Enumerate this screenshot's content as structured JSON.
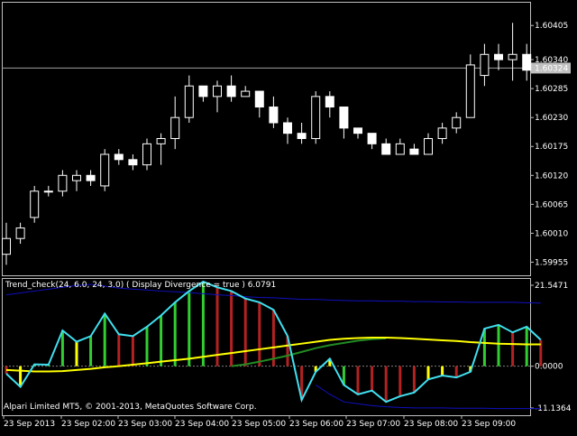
{
  "price_panel": {
    "current_price_tag": "1.60324",
    "price_ticks": [
      "1.60405",
      "1.60340",
      "1.60285",
      "1.60230",
      "1.60175",
      "1.60120",
      "1.60065",
      "1.60010",
      "1.59955"
    ]
  },
  "indicator_panel": {
    "title": "Trend_check(24, 6.0, 24, 3.0) ( Display Divergence = true ) 6.0791",
    "ticks": [
      "21.5471",
      "0.0000",
      "-11.1364"
    ]
  },
  "footer": {
    "copyright": "Alpari Limited MT5, © 2001-2013, MetaQuotes Software Corp."
  },
  "time_axis": {
    "labels": [
      "23 Sep 2013",
      "23 Sep 02:00",
      "23 Sep 03:00",
      "23 Sep 04:00",
      "23 Sep 05:00",
      "23 Sep 06:00",
      "23 Sep 07:00",
      "23 Sep 08:00",
      "23 Sep 09:00"
    ]
  },
  "colors": {
    "background": "#000000",
    "grid": "#c0c0c0",
    "candle": "#ffffff",
    "bar_green": "#32cd32",
    "bar_red": "#b22222",
    "bar_yellow": "#ffff00",
    "line_cyan": "#40e0f0",
    "line_yellow": "#ffff00",
    "line_green": "#228b22",
    "band_blue": "#1010c0",
    "price_tag_bg": "#c0c0c0"
  },
  "chart_data": {
    "type": "candlestick",
    "price_ylim": [
      1.5993,
      1.6045
    ],
    "current_price": 1.60324,
    "candles": [
      {
        "o": 1.5997,
        "h": 1.6003,
        "l": 1.5995,
        "c": 1.6
      },
      {
        "o": 1.6,
        "h": 1.6003,
        "l": 1.5999,
        "c": 1.6002
      },
      {
        "o": 1.6004,
        "h": 1.601,
        "l": 1.6003,
        "c": 1.6009
      },
      {
        "o": 1.6009,
        "h": 1.601,
        "l": 1.6008,
        "c": 1.6009
      },
      {
        "o": 1.6009,
        "h": 1.6013,
        "l": 1.6008,
        "c": 1.6012
      },
      {
        "o": 1.6011,
        "h": 1.6013,
        "l": 1.6009,
        "c": 1.6012
      },
      {
        "o": 1.6012,
        "h": 1.6013,
        "l": 1.601,
        "c": 1.6011
      },
      {
        "o": 1.601,
        "h": 1.6017,
        "l": 1.6009,
        "c": 1.6016
      },
      {
        "o": 1.6016,
        "h": 1.6017,
        "l": 1.6014,
        "c": 1.6015
      },
      {
        "o": 1.6015,
        "h": 1.6016,
        "l": 1.6013,
        "c": 1.6014
      },
      {
        "o": 1.6014,
        "h": 1.6019,
        "l": 1.6013,
        "c": 1.6018
      },
      {
        "o": 1.6018,
        "h": 1.602,
        "l": 1.6014,
        "c": 1.6019
      },
      {
        "o": 1.6019,
        "h": 1.6027,
        "l": 1.6017,
        "c": 1.6023
      },
      {
        "o": 1.6023,
        "h": 1.6031,
        "l": 1.6022,
        "c": 1.6029
      },
      {
        "o": 1.6029,
        "h": 1.6029,
        "l": 1.6026,
        "c": 1.6027
      },
      {
        "o": 1.6027,
        "h": 1.603,
        "l": 1.6024,
        "c": 1.6029
      },
      {
        "o": 1.6029,
        "h": 1.6031,
        "l": 1.6026,
        "c": 1.6027
      },
      {
        "o": 1.6027,
        "h": 1.6029,
        "l": 1.6027,
        "c": 1.6028
      },
      {
        "o": 1.6028,
        "h": 1.6028,
        "l": 1.6023,
        "c": 1.6025
      },
      {
        "o": 1.6025,
        "h": 1.6027,
        "l": 1.6021,
        "c": 1.6022
      },
      {
        "o": 1.6022,
        "h": 1.6023,
        "l": 1.6018,
        "c": 1.602
      },
      {
        "o": 1.602,
        "h": 1.6022,
        "l": 1.6018,
        "c": 1.6019
      },
      {
        "o": 1.6019,
        "h": 1.6028,
        "l": 1.6018,
        "c": 1.6027
      },
      {
        "o": 1.6027,
        "h": 1.6028,
        "l": 1.6023,
        "c": 1.6025
      },
      {
        "o": 1.6025,
        "h": 1.6025,
        "l": 1.6019,
        "c": 1.6021
      },
      {
        "o": 1.6021,
        "h": 1.6021,
        "l": 1.6019,
        "c": 1.602
      },
      {
        "o": 1.602,
        "h": 1.602,
        "l": 1.6017,
        "c": 1.6018
      },
      {
        "o": 1.6018,
        "h": 1.6019,
        "l": 1.6016,
        "c": 1.6016
      },
      {
        "o": 1.6016,
        "h": 1.6019,
        "l": 1.6016,
        "c": 1.6018
      },
      {
        "o": 1.6017,
        "h": 1.6018,
        "l": 1.6016,
        "c": 1.6016
      },
      {
        "o": 1.6016,
        "h": 1.602,
        "l": 1.6016,
        "c": 1.6019
      },
      {
        "o": 1.6019,
        "h": 1.6022,
        "l": 1.6018,
        "c": 1.6021
      },
      {
        "o": 1.6021,
        "h": 1.6024,
        "l": 1.602,
        "c": 1.6023
      },
      {
        "o": 1.6023,
        "h": 1.6035,
        "l": 1.6023,
        "c": 1.6033
      },
      {
        "o": 1.6031,
        "h": 1.6037,
        "l": 1.6029,
        "c": 1.6035
      },
      {
        "o": 1.6035,
        "h": 1.6037,
        "l": 1.6032,
        "c": 1.6034
      },
      {
        "o": 1.6034,
        "h": 1.6041,
        "l": 1.603,
        "c": 1.6035
      },
      {
        "o": 1.6035,
        "h": 1.6037,
        "l": 1.603,
        "c": 1.6032
      }
    ],
    "indicator_ylim": [
      -11.1364,
      21.5471
    ],
    "histogram": [
      {
        "v": -2.0,
        "c": "red"
      },
      {
        "v": -5.5,
        "c": "yellow"
      },
      {
        "v": 0.5,
        "c": "green"
      },
      {
        "v": 0.4,
        "c": "green"
      },
      {
        "v": 9.5,
        "c": "green"
      },
      {
        "v": 6.5,
        "c": "yellow"
      },
      {
        "v": 8.0,
        "c": "green"
      },
      {
        "v": 14.0,
        "c": "green"
      },
      {
        "v": 8.5,
        "c": "red"
      },
      {
        "v": 8.0,
        "c": "red"
      },
      {
        "v": 10.5,
        "c": "green"
      },
      {
        "v": 13.5,
        "c": "green"
      },
      {
        "v": 17.0,
        "c": "green"
      },
      {
        "v": 20.0,
        "c": "green"
      },
      {
        "v": 22.5,
        "c": "green"
      },
      {
        "v": 21.0,
        "c": "red"
      },
      {
        "v": 20.0,
        "c": "red"
      },
      {
        "v": 18.0,
        "c": "red"
      },
      {
        "v": 17.0,
        "c": "red"
      },
      {
        "v": 15.0,
        "c": "red"
      },
      {
        "v": 8.0,
        "c": "red"
      },
      {
        "v": -9.0,
        "c": "red"
      },
      {
        "v": -1.5,
        "c": "yellow"
      },
      {
        "v": 2.0,
        "c": "yellow"
      },
      {
        "v": -5.0,
        "c": "green"
      },
      {
        "v": -7.5,
        "c": "red"
      },
      {
        "v": -6.5,
        "c": "red"
      },
      {
        "v": -9.5,
        "c": "red"
      },
      {
        "v": -8.0,
        "c": "red"
      },
      {
        "v": -7.0,
        "c": "red"
      },
      {
        "v": -3.5,
        "c": "yellow"
      },
      {
        "v": -2.5,
        "c": "yellow"
      },
      {
        "v": -3.0,
        "c": "red"
      },
      {
        "v": -1.5,
        "c": "yellow"
      },
      {
        "v": 10.0,
        "c": "green"
      },
      {
        "v": 11.0,
        "c": "green"
      },
      {
        "v": 9.0,
        "c": "red"
      },
      {
        "v": 10.5,
        "c": "green"
      },
      {
        "v": 7.0,
        "c": "red"
      }
    ],
    "yellow_line": [
      -1.0,
      -1.2,
      -1.4,
      -1.4,
      -1.3,
      -1.0,
      -0.7,
      -0.3,
      0.0,
      0.4,
      0.8,
      1.2,
      1.6,
      2.0,
      2.5,
      3.0,
      3.5,
      4.0,
      4.5,
      5.0,
      5.5,
      6.0,
      6.5,
      7.0,
      7.3,
      7.5,
      7.6,
      7.6,
      7.5,
      7.3,
      7.1,
      6.9,
      6.7,
      6.4,
      6.2,
      6.0,
      5.9,
      5.8,
      5.8
    ],
    "green_line": [
      null,
      null,
      null,
      null,
      null,
      null,
      null,
      null,
      null,
      null,
      null,
      null,
      null,
      null,
      null,
      null,
      0.0,
      0.5,
      1.2,
      2.0,
      2.8,
      3.8,
      4.8,
      5.6,
      6.2,
      6.8,
      7.2,
      7.4
    ],
    "upper_band": [
      19.0,
      19.5,
      20.0,
      20.5,
      21.0,
      21.5,
      21.8,
      21.3,
      20.8,
      20.5,
      20.3,
      20.0,
      19.8,
      19.6,
      19.3,
      19.0,
      18.8,
      18.5,
      18.3,
      18.2,
      18.0,
      17.8,
      17.8,
      17.6,
      17.5,
      17.4,
      17.4,
      17.3,
      17.3,
      17.2,
      17.2,
      17.1,
      17.1,
      17.0,
      17.0,
      17.0,
      17.0,
      16.9,
      16.8
    ],
    "lower_band": [
      null,
      null,
      null,
      null,
      null,
      null,
      null,
      null,
      null,
      null,
      null,
      null,
      null,
      null,
      null,
      null,
      null,
      null,
      null,
      null,
      null,
      null,
      -5.0,
      -7.5,
      -9.5,
      -10.0,
      -10.5,
      -10.8,
      -11.0,
      -11.1,
      -11.1,
      -11.1,
      -11.2,
      -11.2,
      -11.2,
      -11.3,
      -11.3,
      -11.3,
      -11.3
    ]
  }
}
